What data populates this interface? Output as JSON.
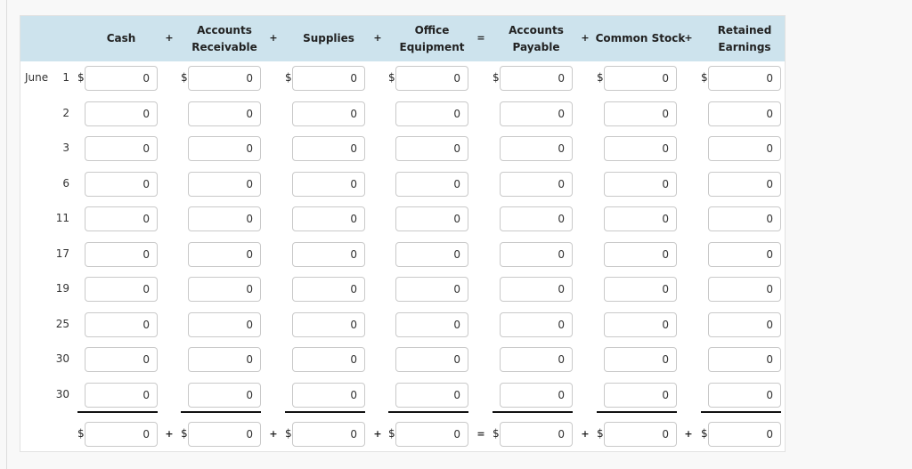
{
  "columns": [
    {
      "key": "cash",
      "label_lines": [
        "Cash"
      ]
    },
    {
      "key": "accounts_receivable",
      "label_lines": [
        "Accounts",
        "Receivable"
      ]
    },
    {
      "key": "supplies",
      "label_lines": [
        "Supplies"
      ]
    },
    {
      "key": "office_equipment",
      "label_lines": [
        "Office",
        "Equipment"
      ]
    },
    {
      "key": "accounts_payable",
      "label_lines": [
        "Accounts",
        "Payable"
      ]
    },
    {
      "key": "common_stock",
      "label_lines": [
        "Common Stock"
      ]
    },
    {
      "key": "retained_earnings",
      "label_lines": [
        "Retained",
        "Earnings"
      ]
    }
  ],
  "header_operators": [
    "+",
    "+",
    "+",
    "=",
    "+",
    "+"
  ],
  "month_label": "June",
  "currency_symbol": "$",
  "rows": [
    {
      "date": "1",
      "values": [
        "0",
        "0",
        "0",
        "0",
        "0",
        "0",
        "0"
      ]
    },
    {
      "date": "2",
      "values": [
        "0",
        "0",
        "0",
        "0",
        "0",
        "0",
        "0"
      ]
    },
    {
      "date": "3",
      "values": [
        "0",
        "0",
        "0",
        "0",
        "0",
        "0",
        "0"
      ]
    },
    {
      "date": "6",
      "values": [
        "0",
        "0",
        "0",
        "0",
        "0",
        "0",
        "0"
      ]
    },
    {
      "date": "11",
      "values": [
        "0",
        "0",
        "0",
        "0",
        "0",
        "0",
        "0"
      ]
    },
    {
      "date": "17",
      "values": [
        "0",
        "0",
        "0",
        "0",
        "0",
        "0",
        "0"
      ]
    },
    {
      "date": "19",
      "values": [
        "0",
        "0",
        "0",
        "0",
        "0",
        "0",
        "0"
      ]
    },
    {
      "date": "25",
      "values": [
        "0",
        "0",
        "0",
        "0",
        "0",
        "0",
        "0"
      ]
    },
    {
      "date": "30",
      "values": [
        "0",
        "0",
        "0",
        "0",
        "0",
        "0",
        "0"
      ]
    },
    {
      "date": "30",
      "values": [
        "0",
        "0",
        "0",
        "0",
        "0",
        "0",
        "0"
      ]
    }
  ],
  "totals": {
    "values": [
      "0",
      "0",
      "0",
      "0",
      "0",
      "0",
      "0"
    ],
    "operators": [
      "+",
      "+",
      "+",
      "=",
      "+",
      "+"
    ]
  },
  "colors": {
    "header_bg": "#cde3ed",
    "page_bg": "#f8f8f8"
  }
}
